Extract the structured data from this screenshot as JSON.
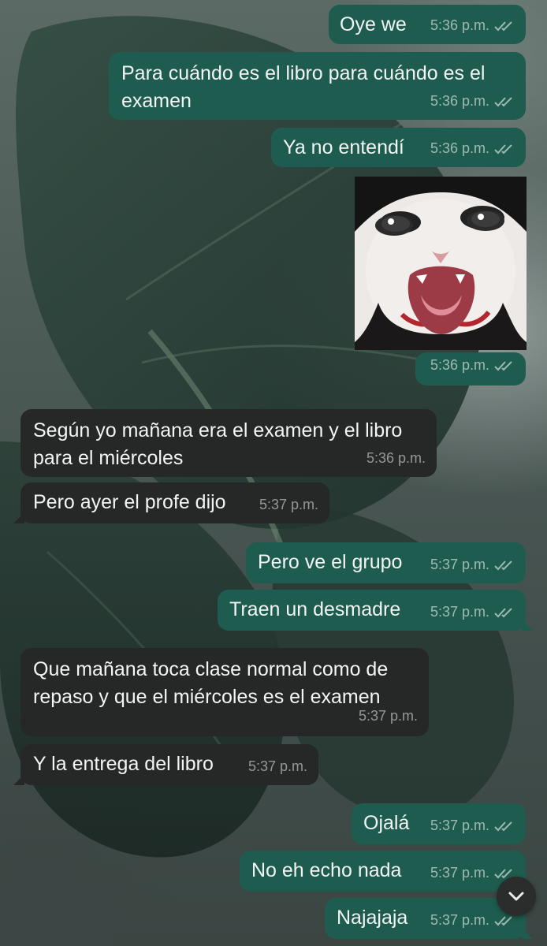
{
  "chat": {
    "messages": [
      {
        "id": "m1",
        "direction": "outgoing",
        "text": "Oye we",
        "time": "5:36 p.m.",
        "read": true
      },
      {
        "id": "m2",
        "direction": "outgoing",
        "text": "Para cuándo es el libro  para cuándo es el\nexamen",
        "time": "5:36 p.m.",
        "read": true
      },
      {
        "id": "m3",
        "direction": "outgoing",
        "text": "Ya no entendí",
        "time": "5:36 p.m.",
        "read": true
      },
      {
        "id": "m4",
        "direction": "outgoing",
        "type": "image",
        "image": "crying-cat-meme",
        "time": "5:36 p.m.",
        "read": true
      },
      {
        "id": "m5",
        "direction": "incoming",
        "text": "Según yo mañana era el examen y el libro\npara el miércoles",
        "time": "5:36 p.m."
      },
      {
        "id": "m6",
        "direction": "incoming",
        "text": "Pero ayer el profe dijo",
        "time": "5:37 p.m."
      },
      {
        "id": "m7",
        "direction": "outgoing",
        "text": "Pero ve el grupo",
        "time": "5:37 p.m.",
        "read": true
      },
      {
        "id": "m8",
        "direction": "outgoing",
        "text": "Traen un desmadre",
        "time": "5:37 p.m.",
        "read": true
      },
      {
        "id": "m9",
        "direction": "incoming",
        "text": "Que mañana toca clase normal como de\nrepaso y que el miércoles es el examen",
        "time": "5:37 p.m."
      },
      {
        "id": "m10",
        "direction": "incoming",
        "text": "Y la entrega del libro",
        "time": "5:37 p.m."
      },
      {
        "id": "m11",
        "direction": "outgoing",
        "text": "Ojalá",
        "time": "5:37 p.m.",
        "read": true
      },
      {
        "id": "m12",
        "direction": "outgoing",
        "text": "No eh echo nada",
        "time": "5:37 p.m.",
        "read": true
      },
      {
        "id": "m13",
        "direction": "outgoing",
        "text": "Najajaja",
        "time": "5:37 p.m.",
        "read": true
      }
    ],
    "scroll_button": {
      "icon": "chevron-down-icon"
    }
  },
  "colors": {
    "outgoing_bubble": "#1e5c4f",
    "incoming_bubble": "#262828",
    "text": "#f2f5f4"
  }
}
